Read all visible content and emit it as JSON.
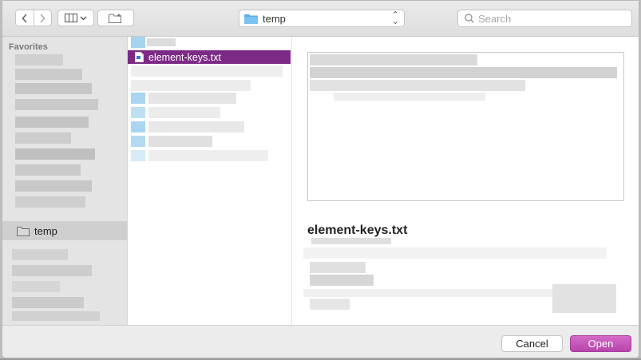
{
  "toolbar": {
    "back_icon": "chevron-left-icon",
    "forward_icon": "chevron-right-icon",
    "view_icon": "columns-view-icon",
    "new_folder_icon": "new-folder-icon",
    "location": {
      "label": "temp",
      "icon": "folder-icon"
    },
    "search": {
      "placeholder": "Search",
      "icon": "search-icon"
    }
  },
  "sidebar": {
    "heading": "Favorites",
    "selected_item": {
      "label": "temp",
      "icon": "folder-icon"
    }
  },
  "file_list": {
    "selected_file": {
      "label": "element-keys.txt",
      "icon": "text-file-icon"
    }
  },
  "preview": {
    "filename": "element-keys.txt"
  },
  "buttons": {
    "cancel": "Cancel",
    "open": "Open"
  },
  "colors": {
    "selection": "#7c2a86",
    "primary_button": "#c457b8",
    "folder": "#5aaee6"
  }
}
